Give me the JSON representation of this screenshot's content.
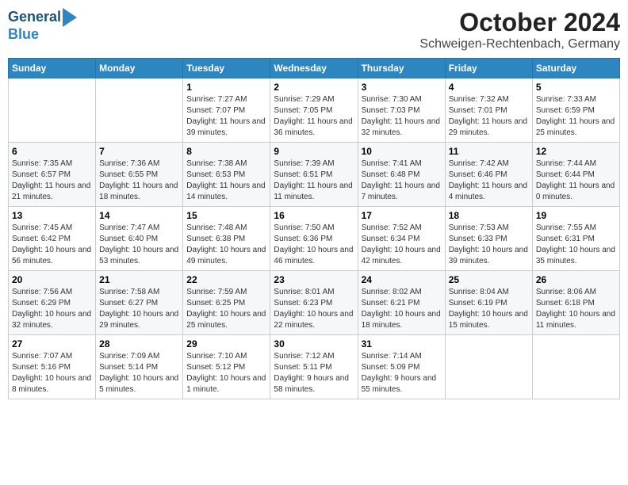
{
  "header": {
    "logo_line1": "General",
    "logo_line2": "Blue",
    "month": "October 2024",
    "location": "Schweigen-Rechtenbach, Germany"
  },
  "weekdays": [
    "Sunday",
    "Monday",
    "Tuesday",
    "Wednesday",
    "Thursday",
    "Friday",
    "Saturday"
  ],
  "weeks": [
    [
      {
        "day": "",
        "info": ""
      },
      {
        "day": "",
        "info": ""
      },
      {
        "day": "1",
        "info": "Sunrise: 7:27 AM\nSunset: 7:07 PM\nDaylight: 11 hours and 39 minutes."
      },
      {
        "day": "2",
        "info": "Sunrise: 7:29 AM\nSunset: 7:05 PM\nDaylight: 11 hours and 36 minutes."
      },
      {
        "day": "3",
        "info": "Sunrise: 7:30 AM\nSunset: 7:03 PM\nDaylight: 11 hours and 32 minutes."
      },
      {
        "day": "4",
        "info": "Sunrise: 7:32 AM\nSunset: 7:01 PM\nDaylight: 11 hours and 29 minutes."
      },
      {
        "day": "5",
        "info": "Sunrise: 7:33 AM\nSunset: 6:59 PM\nDaylight: 11 hours and 25 minutes."
      }
    ],
    [
      {
        "day": "6",
        "info": "Sunrise: 7:35 AM\nSunset: 6:57 PM\nDaylight: 11 hours and 21 minutes."
      },
      {
        "day": "7",
        "info": "Sunrise: 7:36 AM\nSunset: 6:55 PM\nDaylight: 11 hours and 18 minutes."
      },
      {
        "day": "8",
        "info": "Sunrise: 7:38 AM\nSunset: 6:53 PM\nDaylight: 11 hours and 14 minutes."
      },
      {
        "day": "9",
        "info": "Sunrise: 7:39 AM\nSunset: 6:51 PM\nDaylight: 11 hours and 11 minutes."
      },
      {
        "day": "10",
        "info": "Sunrise: 7:41 AM\nSunset: 6:48 PM\nDaylight: 11 hours and 7 minutes."
      },
      {
        "day": "11",
        "info": "Sunrise: 7:42 AM\nSunset: 6:46 PM\nDaylight: 11 hours and 4 minutes."
      },
      {
        "day": "12",
        "info": "Sunrise: 7:44 AM\nSunset: 6:44 PM\nDaylight: 11 hours and 0 minutes."
      }
    ],
    [
      {
        "day": "13",
        "info": "Sunrise: 7:45 AM\nSunset: 6:42 PM\nDaylight: 10 hours and 56 minutes."
      },
      {
        "day": "14",
        "info": "Sunrise: 7:47 AM\nSunset: 6:40 PM\nDaylight: 10 hours and 53 minutes."
      },
      {
        "day": "15",
        "info": "Sunrise: 7:48 AM\nSunset: 6:38 PM\nDaylight: 10 hours and 49 minutes."
      },
      {
        "day": "16",
        "info": "Sunrise: 7:50 AM\nSunset: 6:36 PM\nDaylight: 10 hours and 46 minutes."
      },
      {
        "day": "17",
        "info": "Sunrise: 7:52 AM\nSunset: 6:34 PM\nDaylight: 10 hours and 42 minutes."
      },
      {
        "day": "18",
        "info": "Sunrise: 7:53 AM\nSunset: 6:33 PM\nDaylight: 10 hours and 39 minutes."
      },
      {
        "day": "19",
        "info": "Sunrise: 7:55 AM\nSunset: 6:31 PM\nDaylight: 10 hours and 35 minutes."
      }
    ],
    [
      {
        "day": "20",
        "info": "Sunrise: 7:56 AM\nSunset: 6:29 PM\nDaylight: 10 hours and 32 minutes."
      },
      {
        "day": "21",
        "info": "Sunrise: 7:58 AM\nSunset: 6:27 PM\nDaylight: 10 hours and 29 minutes."
      },
      {
        "day": "22",
        "info": "Sunrise: 7:59 AM\nSunset: 6:25 PM\nDaylight: 10 hours and 25 minutes."
      },
      {
        "day": "23",
        "info": "Sunrise: 8:01 AM\nSunset: 6:23 PM\nDaylight: 10 hours and 22 minutes."
      },
      {
        "day": "24",
        "info": "Sunrise: 8:02 AM\nSunset: 6:21 PM\nDaylight: 10 hours and 18 minutes."
      },
      {
        "day": "25",
        "info": "Sunrise: 8:04 AM\nSunset: 6:19 PM\nDaylight: 10 hours and 15 minutes."
      },
      {
        "day": "26",
        "info": "Sunrise: 8:06 AM\nSunset: 6:18 PM\nDaylight: 10 hours and 11 minutes."
      }
    ],
    [
      {
        "day": "27",
        "info": "Sunrise: 7:07 AM\nSunset: 5:16 PM\nDaylight: 10 hours and 8 minutes."
      },
      {
        "day": "28",
        "info": "Sunrise: 7:09 AM\nSunset: 5:14 PM\nDaylight: 10 hours and 5 minutes."
      },
      {
        "day": "29",
        "info": "Sunrise: 7:10 AM\nSunset: 5:12 PM\nDaylight: 10 hours and 1 minute."
      },
      {
        "day": "30",
        "info": "Sunrise: 7:12 AM\nSunset: 5:11 PM\nDaylight: 9 hours and 58 minutes."
      },
      {
        "day": "31",
        "info": "Sunrise: 7:14 AM\nSunset: 5:09 PM\nDaylight: 9 hours and 55 minutes."
      },
      {
        "day": "",
        "info": ""
      },
      {
        "day": "",
        "info": ""
      }
    ]
  ]
}
